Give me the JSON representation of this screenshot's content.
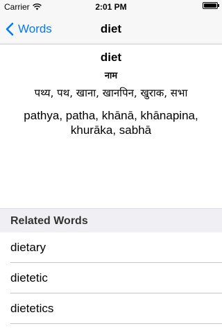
{
  "status_bar": {
    "carrier": "Carrier",
    "time": "2:01 PM",
    "battery_level": 1.0
  },
  "nav": {
    "back_label": "Words",
    "title": "diet"
  },
  "entry": {
    "word": "diet",
    "part_of_speech": "नाम",
    "translation_native": "पथ्य, पथ, खाना, खानपिन, खुराक, सभा",
    "translation_romanized": "pathya, patha, khānā, khānapina, khurāka, sabhā"
  },
  "related": {
    "header": "Related Words",
    "items": [
      "dietary",
      "dietetic",
      "dietetics"
    ]
  },
  "colors": {
    "accent": "#007aff",
    "section_bg": "#efeff4",
    "separator": "#c8c7cc"
  }
}
